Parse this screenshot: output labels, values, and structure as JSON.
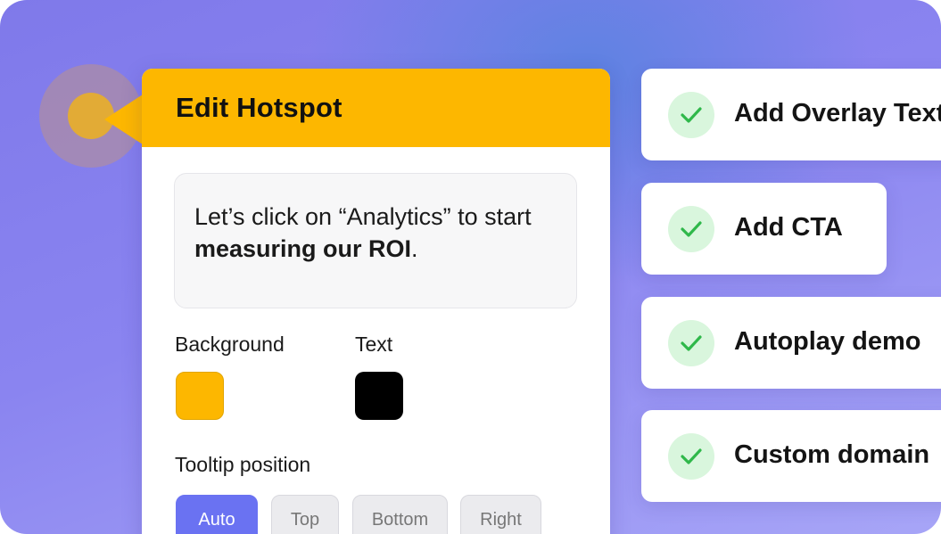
{
  "editor": {
    "title": "Edit Hotspot",
    "tooltip_text_plain": "Let’s click on “Analytics” to start ",
    "tooltip_text_bold": "measuring our ROI",
    "tooltip_text_end": ".",
    "background_label": "Background",
    "text_label": "Text",
    "background_color": "#fdb700",
    "text_color": "#000000",
    "position_label": "Tooltip position",
    "positions": [
      {
        "label": "Auto",
        "active": true
      },
      {
        "label": "Top",
        "active": false
      },
      {
        "label": "Bottom",
        "active": false
      },
      {
        "label": "Right",
        "active": false
      }
    ]
  },
  "features": [
    {
      "label": "Add Overlay Text",
      "icon": "check-icon"
    },
    {
      "label": "Add CTA",
      "icon": "check-icon"
    },
    {
      "label": "Autoplay demo",
      "icon": "check-icon"
    },
    {
      "label": "Custom domain",
      "icon": "check-icon"
    }
  ],
  "colors": {
    "accent": "#6a72f2",
    "hotspot": "#fdb700",
    "check": "#2fb84a"
  }
}
